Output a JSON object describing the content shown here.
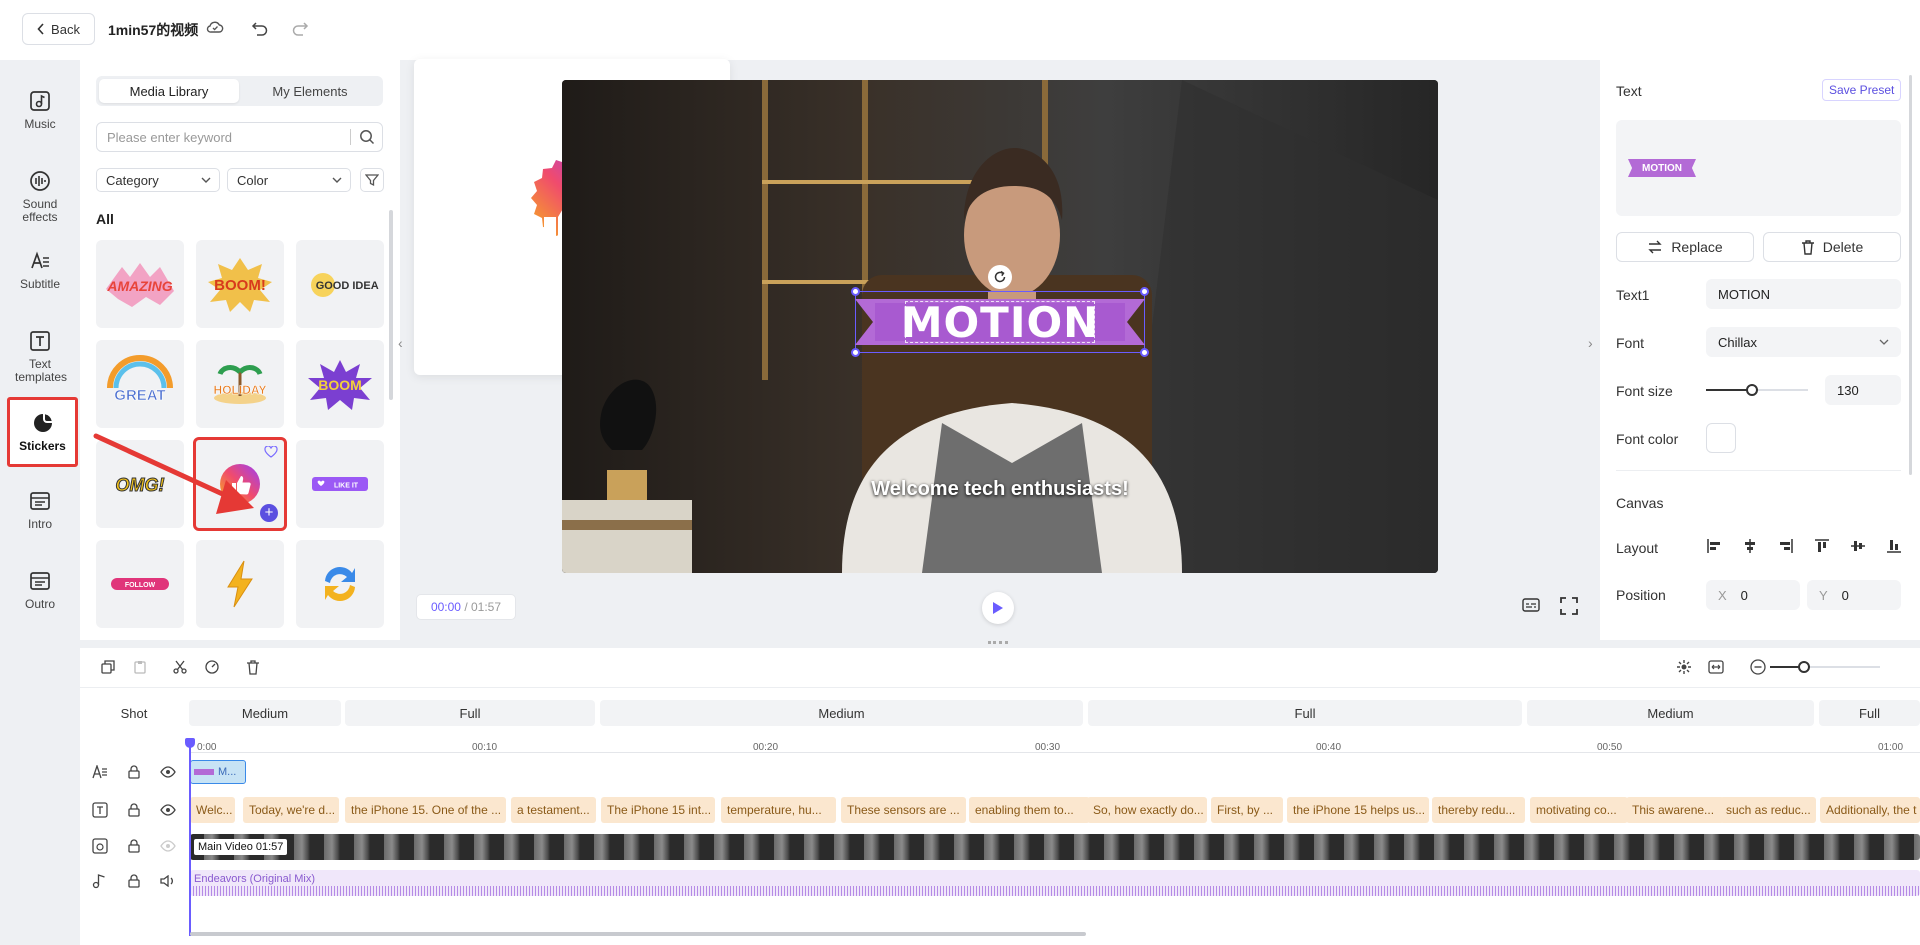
{
  "topbar": {
    "back_label": "Back",
    "project_title": "1min57的视频"
  },
  "rail": {
    "items": [
      {
        "label": "Music",
        "icon": "music-icon"
      },
      {
        "label": "Sound effects",
        "icon": "sound-effects-icon"
      },
      {
        "label": "Subtitle",
        "icon": "subtitle-icon"
      },
      {
        "label": "Text templates",
        "icon": "text-templates-icon"
      },
      {
        "label": "Stickers",
        "icon": "stickers-icon",
        "active": true
      },
      {
        "label": "Intro",
        "icon": "intro-icon"
      },
      {
        "label": "Outro",
        "icon": "outro-icon"
      }
    ]
  },
  "media": {
    "tabs": [
      "Media Library",
      "My Elements"
    ],
    "search_placeholder": "Please enter keyword",
    "category_label": "Category",
    "color_label": "Color",
    "section_label": "All",
    "stickers": [
      {
        "text": "AMAZING",
        "color": "#e8443a"
      },
      {
        "text": "BOOM!",
        "color": "#e85a1c"
      },
      {
        "text": "GOOD IDEA!",
        "color": "#e8a21c"
      },
      {
        "text": "GREAT",
        "color": "#4b8de0"
      },
      {
        "text": "HOLIDAY",
        "color": "#e87a1c"
      },
      {
        "text": "BOOM",
        "color": "#8a3fd1"
      },
      {
        "text": "OMG!",
        "color": "#e8b81c"
      },
      {
        "text": "thumbs-up",
        "color": "#e8443a"
      },
      {
        "text": "LIKE IT",
        "color": "#9b59f5"
      },
      {
        "text": "FOLLOW",
        "color": "#e0357a"
      },
      {
        "text": "lightning",
        "color": "#f0a81c"
      },
      {
        "text": "refresh",
        "color": "#3a8ae8"
      }
    ]
  },
  "preview": {
    "overlay_text": "MOTION",
    "subtitle": "Welcome tech enthusiasts!",
    "time_current": "00:00",
    "time_total": "/ 01:57"
  },
  "right_panel": {
    "section_text": "Text",
    "save_preset": "Save Preset",
    "preview_chip": "MOTION",
    "replace_label": "Replace",
    "delete_label": "Delete",
    "text1_label": "Text1",
    "text1_value": "MOTION",
    "font_label": "Font",
    "font_value": "Chillax",
    "font_size_label": "Font size",
    "font_size_value": "130",
    "font_size_level": 0.45,
    "font_color_label": "Font color",
    "canvas_label": "Canvas",
    "layout_label": "Layout",
    "position_label": "Position",
    "pos_x_label": "X",
    "pos_x_value": "0",
    "pos_y_label": "Y",
    "pos_y_value": "0"
  },
  "timeline": {
    "shot_label": "Shot",
    "shots": [
      "Medium",
      "Full",
      "Medium",
      "Full",
      "Medium",
      "Full"
    ],
    "ticks": [
      "0:00",
      "00:10",
      "00:20",
      "00:30",
      "00:40",
      "00:50",
      "01:00"
    ],
    "sticker_clip": "M...",
    "subtitle_clips": [
      "Welc...",
      "Today, we're d...",
      "the iPhone 15. One of the ...",
      "a testament...",
      "The iPhone 15 int...",
      "temperature, hu...",
      "These sensors are ...",
      "enabling them to...",
      "So, how exactly do...",
      "First, by ...",
      "the iPhone 15 helps us...",
      "thereby redu...",
      "motivating co...",
      "This awarene...",
      "such as reduc...",
      "Additionally, the t"
    ],
    "main_video_label": "Main Video 01:57",
    "audio_label": "Endeavors (Original Mix)"
  },
  "colors": {
    "accent": "#6a5cff",
    "highlight": "#e53935",
    "banner": "#b36ad6"
  }
}
